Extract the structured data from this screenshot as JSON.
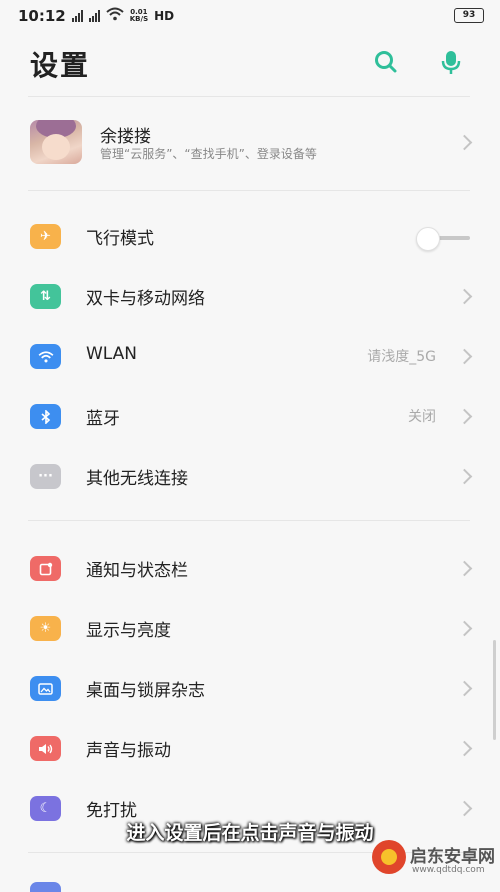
{
  "status_bar": {
    "time": "10:12",
    "sim1": "4G",
    "sim2": "4G",
    "speed_value": "0.01",
    "speed_unit": "KB/S",
    "hd": "HD",
    "battery": "93"
  },
  "header": {
    "title": "设置",
    "search_icon": "search-icon",
    "mic_icon": "mic-icon",
    "accent_color": "#2fbf9a"
  },
  "profile": {
    "name": "余搂搂",
    "subtitle": "管理“云服务”、“查找手机”、登录设备等"
  },
  "group1": [
    {
      "label": "飞行模式",
      "icon": "airplane-icon",
      "icon_color": "#f8b24b",
      "toggle": false
    },
    {
      "label": "双卡与移动网络",
      "icon": "sim-data-icon",
      "icon_color": "#43c49a"
    },
    {
      "label": "WLAN",
      "icon": "wifi-icon",
      "icon_color": "#3d8ef0",
      "value": "请浅度_5G"
    },
    {
      "label": "蓝牙",
      "icon": "bluetooth-icon",
      "icon_color": "#3d8ef0",
      "value": "关闭"
    },
    {
      "label": "其他无线连接",
      "icon": "more-icon",
      "icon_color": "#c7c7cc"
    }
  ],
  "group2": [
    {
      "label": "通知与状态栏",
      "icon": "notification-icon",
      "icon_color": "#ef6a67"
    },
    {
      "label": "显示与亮度",
      "icon": "brightness-icon",
      "icon_color": "#f8b24b"
    },
    {
      "label": "桌面与锁屏杂志",
      "icon": "wallpaper-icon",
      "icon_color": "#3d8ef0"
    },
    {
      "label": "声音与振动",
      "icon": "sound-icon",
      "icon_color": "#ef6a67"
    },
    {
      "label": "免打扰",
      "icon": "moon-icon",
      "icon_color": "#7b72e0"
    }
  ],
  "caption": "进入设置后在点击声音与振动",
  "watermark": {
    "text": "启东安卓网",
    "url": "www.qdtdq.com"
  }
}
